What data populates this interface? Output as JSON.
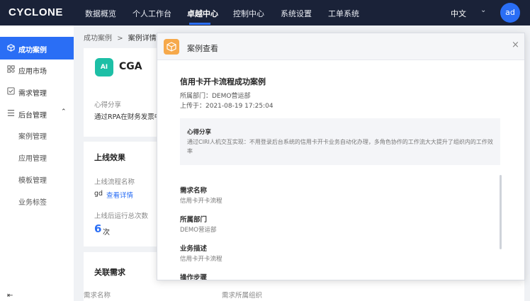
{
  "header": {
    "logo": "CYCLONE",
    "nav": [
      "数据概览",
      "个人工作台",
      "卓越中心",
      "控制中心",
      "系统设置",
      "工单系统"
    ],
    "active_nav": "卓越中心",
    "language": "中文",
    "avatar": "ad"
  },
  "sidebar": {
    "items": [
      "成功案例",
      "应用市场",
      "需求管理",
      "后台管理"
    ],
    "sub_items": [
      "案例管理",
      "应用管理",
      "模板管理",
      "业务标签"
    ]
  },
  "breadcrumb": {
    "parent": "成功案例",
    "separator": ">",
    "current": "案例详情"
  },
  "app": {
    "icon_text": "AI",
    "name": "CGA"
  },
  "experience": {
    "label": "心得分享",
    "text": "通过RPA在财务发票中"
  },
  "online": {
    "title": "上线效果",
    "flow_label": "上线流程名称",
    "flow_value": "gd",
    "view_link": "查看详情",
    "runs_label": "上线后运行总次数",
    "runs_value": "6",
    "runs_unit": "次"
  },
  "related": {
    "title": "关联需求",
    "col_req": "需求名称",
    "col_org": "需求所属组织"
  },
  "modal": {
    "title": "案例查看",
    "close": "×",
    "case_title": "信用卡开卡流程成功案例",
    "dept": "所属部门：DEMO营运部",
    "uploaded": "上传于：2021-08-19 17:25:04",
    "insight_title": "心得分享",
    "insight_text": "通过CIRI人机交互实现：不用登录后台系统的信用卡开卡业务自动化办理，多角色协作的工作流大大提升了组织内的工作效率",
    "fields": [
      {
        "label": "需求名称",
        "value": "信用卡开卡流程"
      },
      {
        "label": "所属部门",
        "value": "DEMO营运部"
      },
      {
        "label": "业务描述",
        "value": "信用卡开卡流程"
      },
      {
        "label": "操作步骤",
        "value": ""
      }
    ]
  },
  "colors": {
    "nav_bg": "#1a2238",
    "accent": "#2a6ef5",
    "app_icon": "#1dbfa6",
    "modal_icon": "#f6a94b"
  }
}
